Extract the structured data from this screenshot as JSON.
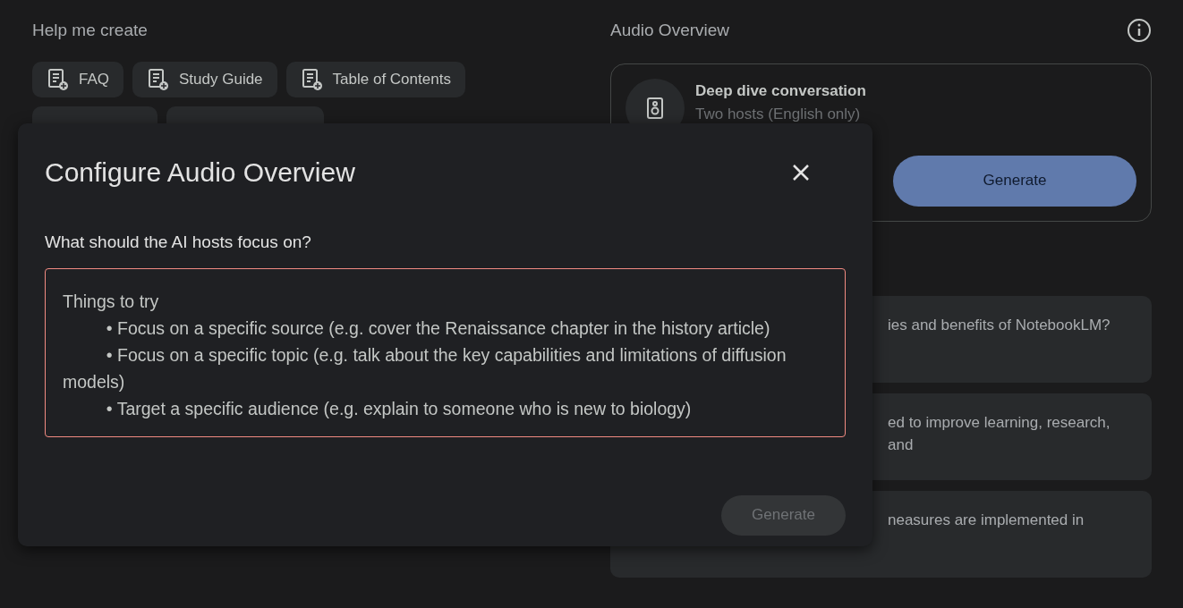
{
  "help": {
    "title": "Help me create",
    "chips": [
      {
        "label": "FAQ"
      },
      {
        "label": "Study Guide"
      },
      {
        "label": "Table of Contents"
      }
    ]
  },
  "audio": {
    "title": "Audio Overview",
    "card": {
      "title": "Deep dive conversation",
      "subtitle": "Two hosts (English only)",
      "button": "Generate"
    }
  },
  "questions": [
    {
      "text": "ies and benefits of NotebookLM?"
    },
    {
      "text": "ed to improve learning, research, and"
    },
    {
      "text": "neasures are implemented in"
    }
  ],
  "dialog": {
    "title": "Configure Audio Overview",
    "label": "What should the AI hosts focus on?",
    "placeholder": "Things to try\n\t• Focus on a specific source (e.g. cover the Renaissance chapter in the history article)\n\t• Focus on a specific topic (e.g. talk about the key capabilities and limitations of diffusion models)\n\t• Target a specific audience (e.g. explain to someone who is new to biology)",
    "button": {
      "label": "Generate",
      "disabled": true
    }
  }
}
